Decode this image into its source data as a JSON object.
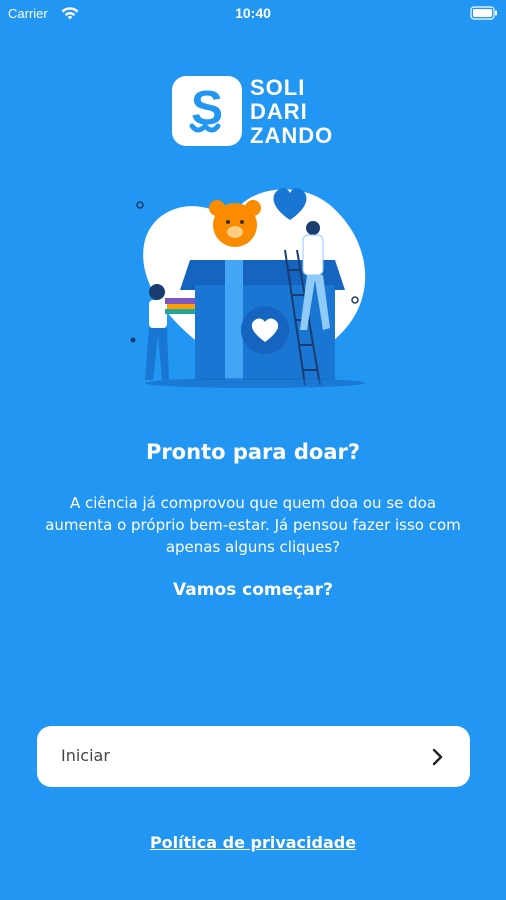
{
  "status_bar": {
    "carrier": "Carrier",
    "time": "10:40",
    "icons": [
      "wifi-icon",
      "battery-icon"
    ]
  },
  "brand": {
    "logo_letter": "S",
    "line1": "SOLI",
    "line2": "DARI",
    "line3": "ZANDO",
    "logo_bg": "#FFFFFF",
    "logo_accent": "#2196F3"
  },
  "onboarding": {
    "title": "Pronto para doar?",
    "description": "A ciência já comprovou que quem doa ou se doa aumenta o próprio bem-estar. Já pensou fazer isso com apenas alguns cliques?",
    "cta": "Vamos começar?"
  },
  "actions": {
    "start_label": "Iniciar",
    "start_icon": "chevron-right-icon",
    "privacy_label": "Política de privacidade"
  },
  "colors": {
    "background": "#2196F3",
    "button_bg": "#FFFFFF",
    "text_primary": "#FFFFFF"
  }
}
